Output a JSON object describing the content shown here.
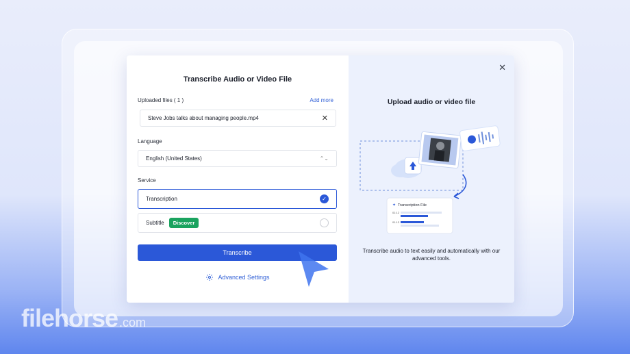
{
  "modal": {
    "title": "Transcribe Audio or Video File",
    "uploaded_label": "Uploaded files ( 1 )",
    "add_more": "Add more",
    "file_name": "Steve Jobs talks about managing people.mp4",
    "language_label": "Language",
    "language_value": "English (United States)",
    "service_label": "Service",
    "service_options": [
      {
        "label": "Transcription",
        "selected": true
      },
      {
        "label": "Subtitle",
        "badge": "Discover",
        "selected": false
      }
    ],
    "transcribe_button": "Transcribe",
    "advanced_settings": "Advanced Settings"
  },
  "panel": {
    "title": "Upload audio or video file",
    "description": "Transcribe audio to text easily and automatically with our advanced tools.",
    "card_title": "Transcription File",
    "card_rows": [
      "01:12",
      "01:13"
    ]
  },
  "watermark": {
    "main": "filehorse",
    "suffix": ".com"
  },
  "colors": {
    "accent": "#2b58d8",
    "badge": "#1aa35f",
    "panel_bg": "#ecf1fd"
  }
}
